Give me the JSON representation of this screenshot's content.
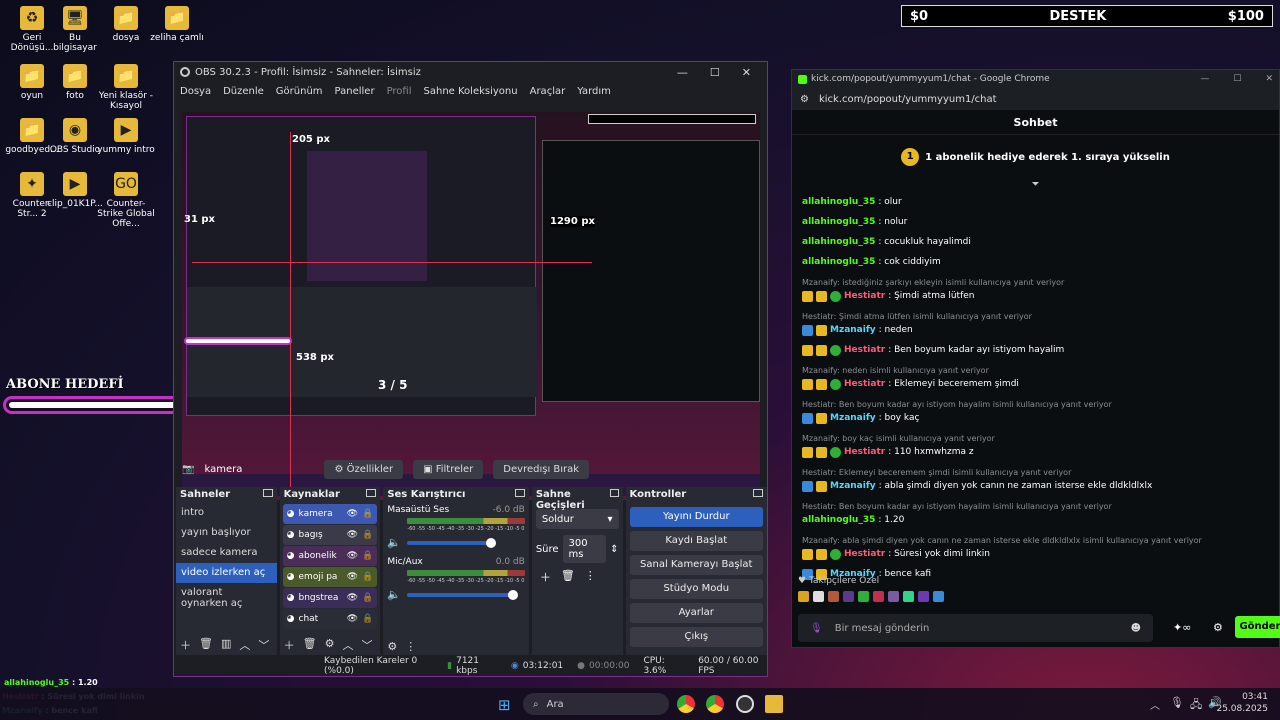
{
  "desktop": {
    "icons": [
      {
        "label": "Geri Dönüşü...",
        "icon": "recycle-bin-icon",
        "glyph": "♻"
      },
      {
        "label": "Bu bilgisayar",
        "icon": "computer-icon",
        "glyph": "🖥"
      },
      {
        "label": "dosya",
        "icon": "folder-icon",
        "glyph": "📁"
      },
      {
        "label": "zeliha çamlı",
        "icon": "folder-icon",
        "glyph": "📁"
      },
      {
        "label": "oyun",
        "icon": "folder-icon",
        "glyph": "📁"
      },
      {
        "label": "foto",
        "icon": "folder-icon",
        "glyph": "📁"
      },
      {
        "label": "Yeni klasör - Kısayol",
        "icon": "folder-shortcut-icon",
        "glyph": "📁"
      },
      {
        "label": "goodbyed...",
        "icon": "folder-icon",
        "glyph": "📁"
      },
      {
        "label": "OBS Studio",
        "icon": "obs-icon",
        "glyph": "◉"
      },
      {
        "label": "yummy intro",
        "icon": "video-icon",
        "glyph": "▶"
      },
      {
        "label": "Counter-Str... 2",
        "icon": "cs2-icon",
        "glyph": "✦"
      },
      {
        "label": "clip_01K1P...",
        "icon": "video-icon",
        "glyph": "▶"
      },
      {
        "label": "Counter-Strike Global Offe...",
        "icon": "csgo-icon",
        "glyph": "GO"
      }
    ]
  },
  "overlay": {
    "donate_left": "$0",
    "donate_title": "DESTEK",
    "donate_right": "$100",
    "abone_title": "ABONE HEDEFİ",
    "abone_progress": 0.6,
    "chat": [
      {
        "user": "allahinoglu_35",
        "text": " : 1.20"
      },
      {
        "user": "Hestiatr",
        "text": " : Süresi yok dimi linkin"
      },
      {
        "user": "Mzanaify",
        "text": " : bence kafi"
      }
    ]
  },
  "obs": {
    "title": "OBS 30.2.3 - Profil: İsimsiz - Sahneler: İsimsiz",
    "menu": [
      "Dosya",
      "Düzenle",
      "Görünüm",
      "Paneller",
      "Profil",
      "Sahne Koleksiyonu",
      "Araçlar",
      "Yardım"
    ],
    "preview_labels": {
      "px1": "205 px",
      "px2": "1290 px",
      "px3": "31 px",
      "px4": "538 px",
      "ratio": "3 / 5"
    },
    "source_bar": {
      "source": "kamera",
      "props": "Özellikler",
      "filters": "Filtreler",
      "deactivate": "Devredışı Bırak"
    },
    "scenes": {
      "title": "Sahneler",
      "items": [
        "intro",
        "yayın başlıyor",
        "sadece kamera",
        "video izlerken aç",
        "valorant oynarken aç"
      ],
      "selected": 3
    },
    "sources": {
      "title": "Kaynaklar",
      "items": [
        {
          "name": "kamera",
          "color": "#3c58b0"
        },
        {
          "name": "bagış",
          "color": "#3a3a48"
        },
        {
          "name": "abonelik",
          "color": "#4a2e58"
        },
        {
          "name": "emoji pa",
          "color": "#4a5a2a"
        },
        {
          "name": "bngstrea",
          "color": "#3a2e58"
        },
        {
          "name": "chat",
          "color": "#2a2c36"
        }
      ]
    },
    "mixer": {
      "title": "Ses Karıştırıcı",
      "channels": [
        {
          "name": "Masaüstü Ses",
          "db": "-6.0 dB",
          "level": 0.8
        },
        {
          "name": "Mic/Aux",
          "db": "0.0 dB",
          "level": 1.0
        }
      ],
      "scale": "-60 -55 -50 -45 -40 -35 -30 -25 -20 -15 -10 -5 0"
    },
    "transitions": {
      "title": "Sahne Geçişleri",
      "type": "Soldur",
      "duration_label": "Süre",
      "duration": "300 ms"
    },
    "controls": {
      "title": "Kontroller",
      "stop_stream": "Yayını Durdur",
      "start_rec": "Kaydı Başlat",
      "virtual_cam": "Sanal Kamerayı Başlat",
      "studio": "Stüdyo Modu",
      "settings": "Ayarlar",
      "exit": "Çıkış"
    },
    "status": {
      "dropped": "Kaybedilen Kareler 0 (%0.0)",
      "bitrate": "7121 kbps",
      "stream_time": "03:12:01",
      "rec_time": "00:00:00",
      "cpu": "CPU: 3.6%",
      "fps": "60.00 / 60.00 FPS"
    }
  },
  "chrome": {
    "title": "kick.com/popout/yummyyum1/chat - Google Chrome",
    "url": "kick.com/popout/yummyyum1/chat",
    "header": "Sohbet",
    "pinned": "1 abonelik hediye ederek 1. sıraya yükselin",
    "messages": [
      {
        "user": "allahinoglu_35",
        "color": "green",
        "text": ": olur"
      },
      {
        "user": "allahinoglu_35",
        "color": "green",
        "text": ": nolur"
      },
      {
        "user": "allahinoglu_35",
        "color": "green",
        "text": ": cocukluk hayalimdi"
      },
      {
        "user": "allahinoglu_35",
        "color": "green",
        "text": ": cok ciddiyim"
      },
      {
        "reply": "Mzanaify: istediğiniz şarkıyı ekleyin isimli kullanıcıya yanıt veriyor",
        "user": "Hestiatr",
        "color": "red",
        "text": ": Şimdi atma lütfen"
      },
      {
        "reply": "Hestiatr: Şimdi atma lütfen isimli kullanıcıya yanıt veriyor",
        "user": "Mzanaify",
        "color": "cyan",
        "text": ": neden"
      },
      {
        "user": "Hestiatr",
        "color": "red",
        "text": ": Ben boyum kadar ayı istiyom hayalim"
      },
      {
        "reply": "Mzanaify: neden isimli kullanıcıya yanıt veriyor",
        "user": "Hestiatr",
        "color": "red",
        "text": ": Eklemeyi beceremem şimdi"
      },
      {
        "reply": "Hestiatr: Ben boyum kadar ayı istiyom hayalim isimli kullanıcıya yanıt veriyor",
        "user": "Mzanaify",
        "color": "cyan",
        "text": ": boy kaç"
      },
      {
        "reply": "Mzanaify: boy kaç isimli kullanıcıya yanıt veriyor",
        "user": "Hestiatr",
        "color": "red",
        "text": ": 110 hxmwhzma z"
      },
      {
        "reply": "Hestiatr: Eklemeyi beceremem şimdi isimli kullanıcıya yanıt veriyor",
        "user": "Mzanaify",
        "color": "cyan",
        "text": ": abla şimdi diyen yok canın ne zaman isterse ekle dldkldlxlx"
      },
      {
        "reply": "Hestiatr: Ben boyum kadar ayı istiyom hayalim isimli kullanıcıya yanıt veriyor",
        "user": "allahinoglu_35",
        "color": "green",
        "text": ": 1.20"
      },
      {
        "reply": "Mzanaify: abla şimdi diyen yok canın ne zaman isterse ekle dldkldlxlx isimli kullanıcıya yanıt veriyor",
        "user": "Hestiatr",
        "color": "red",
        "text": ": Süresi yok dimi linkin"
      },
      {
        "user": "Mzanaify",
        "color": "cyan",
        "text": ": bence kafi"
      }
    ],
    "followers_only": "Takipçilere Özel",
    "input_placeholder": "Bir mesaj gönderin",
    "send": "Gönder"
  },
  "taskbar": {
    "search": "Ara",
    "time": "03:41",
    "date": "25.08.2025"
  },
  "colors": {
    "kick_green": "#53fc18",
    "obs_blue": "#2d5fbd",
    "overlay_pink": "#c531c5"
  }
}
